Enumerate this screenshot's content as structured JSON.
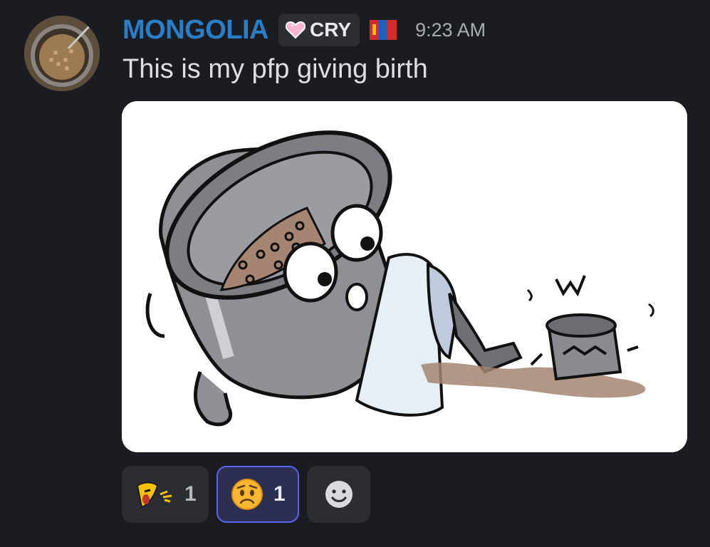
{
  "message": {
    "username": "MONGOLIA",
    "tag": {
      "icon": "pink-heart-icon",
      "text": "CRY"
    },
    "flag_icon": "mongolia-flag-icon",
    "timestamp": "9:23 AM",
    "text": "This is my pfp giving birth",
    "attachment_icon": "cooking-pot-drawing"
  },
  "reactions": [
    {
      "icon": "banana-face-emoji-icon",
      "count": "1",
      "selected": false
    },
    {
      "icon": "worried-face-emoji-icon",
      "count": "1",
      "selected": true
    }
  ],
  "add_reaction_icon": "smiley-add-icon",
  "colors": {
    "background": "#1b1c21",
    "username": "#2a7ec8",
    "selected_reaction_border": "#5865f2"
  }
}
